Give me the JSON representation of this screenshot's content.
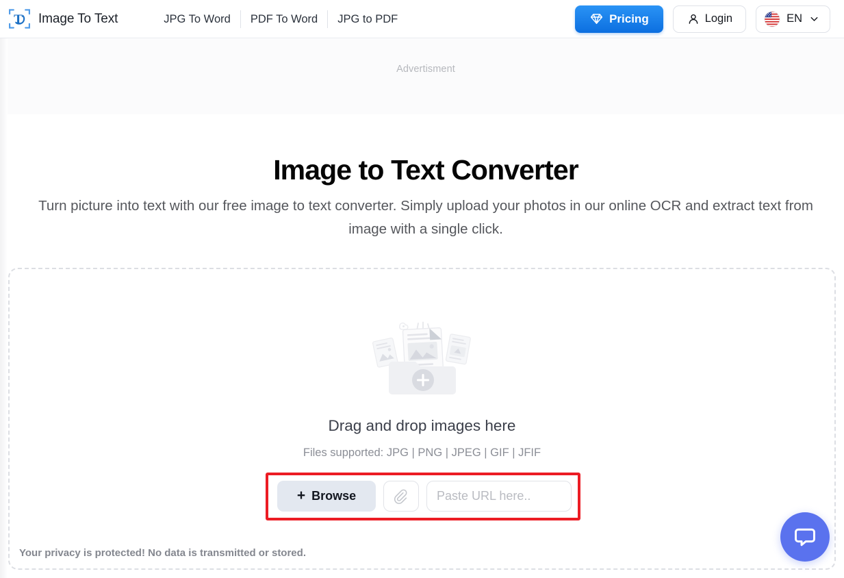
{
  "header": {
    "brand": {
      "logo_icon": "scan-text-logo-icon",
      "name": "Image To Text"
    },
    "nav": [
      {
        "label": "JPG To Word"
      },
      {
        "label": "PDF To Word"
      },
      {
        "label": "JPG to PDF"
      }
    ],
    "pricing": {
      "label": "Pricing",
      "icon": "diamond-icon",
      "color": "#0c6fe0"
    },
    "login": {
      "label": "Login",
      "icon": "user-icon"
    },
    "language": {
      "label": "EN",
      "flag": "us-flag-icon",
      "chevron": "chevron-down-icon"
    }
  },
  "ad": {
    "label": "Advertisment"
  },
  "hero": {
    "title": "Image to Text Converter",
    "subtitle": "Turn picture into text with our free image to text converter. Simply upload your photos in our online OCR and extract text from image with a single click."
  },
  "dropzone": {
    "illustration": "upload-files-folder-illustration",
    "title": "Drag and drop images here",
    "formats": "Files supported: JPG | PNG | JPEG | GIF | JFIF",
    "browse": {
      "label": "Browse",
      "plus": "+"
    },
    "attach": {
      "icon": "paperclip-icon"
    },
    "url": {
      "value": "",
      "placeholder": "Paste URL here.."
    },
    "privacy": "Your privacy is protected! No data is transmitted or stored.",
    "highlight_color": "#ec1c24"
  },
  "chat": {
    "icon": "chat-bubble-icon",
    "color": "#5a72ee"
  }
}
